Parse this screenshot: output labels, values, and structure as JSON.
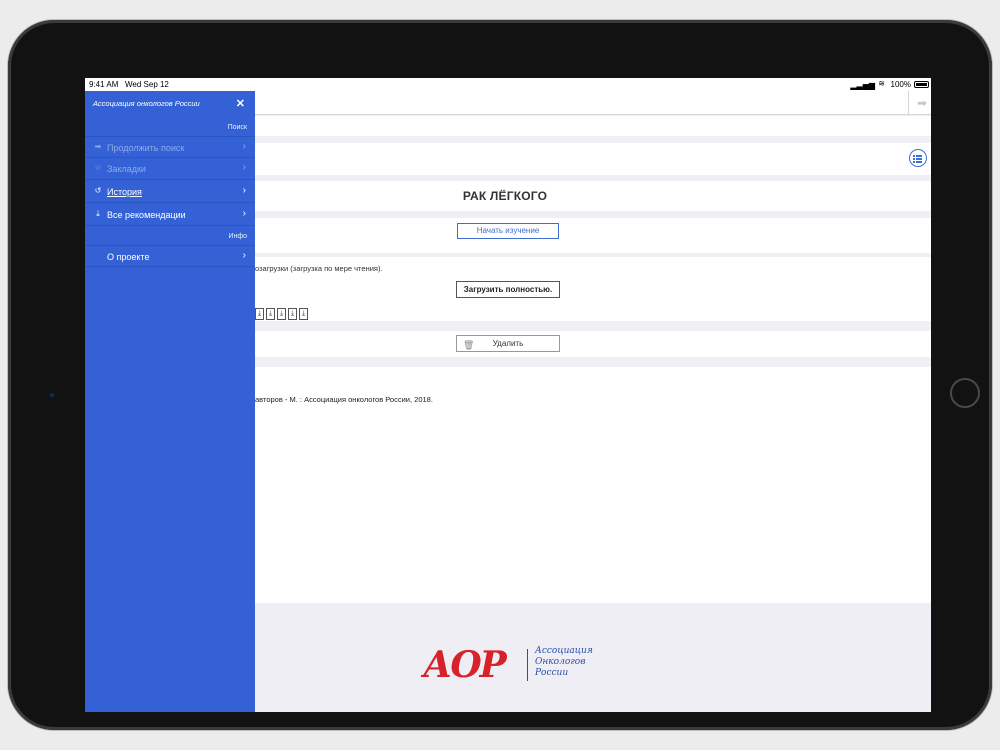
{
  "status_bar": {
    "time": "9:41 AM",
    "date": "Wed Sep 12",
    "battery_text": "100%"
  },
  "sidebar": {
    "title": "Ассоциация онкологов России",
    "close_glyph": "✕",
    "sections": {
      "search_label": "Поиск",
      "info_label": "Инфо"
    },
    "items": [
      {
        "label": "Продолжить поиск",
        "icon": "arrow-right-icon",
        "glyph": "➡",
        "enabled": false
      },
      {
        "label": "Закладки",
        "icon": "star-icon",
        "glyph": "☆",
        "enabled": false
      },
      {
        "label": "История",
        "icon": "history-icon",
        "glyph": "↺",
        "enabled": true,
        "active": true
      },
      {
        "label": "Все рекомендации",
        "icon": "download-tray-icon",
        "glyph": "⤓",
        "enabled": true
      },
      {
        "label": "О проекте",
        "icon": "",
        "glyph": "",
        "enabled": true
      }
    ],
    "chevron_glyph": "›"
  },
  "main": {
    "title": "РАК ЛЁГКОГО",
    "start_button_label": "Начать изучение",
    "lazy_text": "озагрузки (загрузка по мере чтения).",
    "load_full_button_label": "Загрузить полностью.",
    "delete_button_label": "Удалить",
    "authors_text": "авторов - М. : Ассоциация онкологов России, 2018."
  },
  "footer": {
    "logo_mark": "АОР",
    "logo_lines": [
      "Ассоциация",
      "Онкологов",
      "России"
    ]
  },
  "colors": {
    "sidebar_bg": "#3462d6",
    "accent": "#3d6fcf",
    "logo_red": "#d8222a",
    "logo_blue": "#2a4fa8"
  }
}
